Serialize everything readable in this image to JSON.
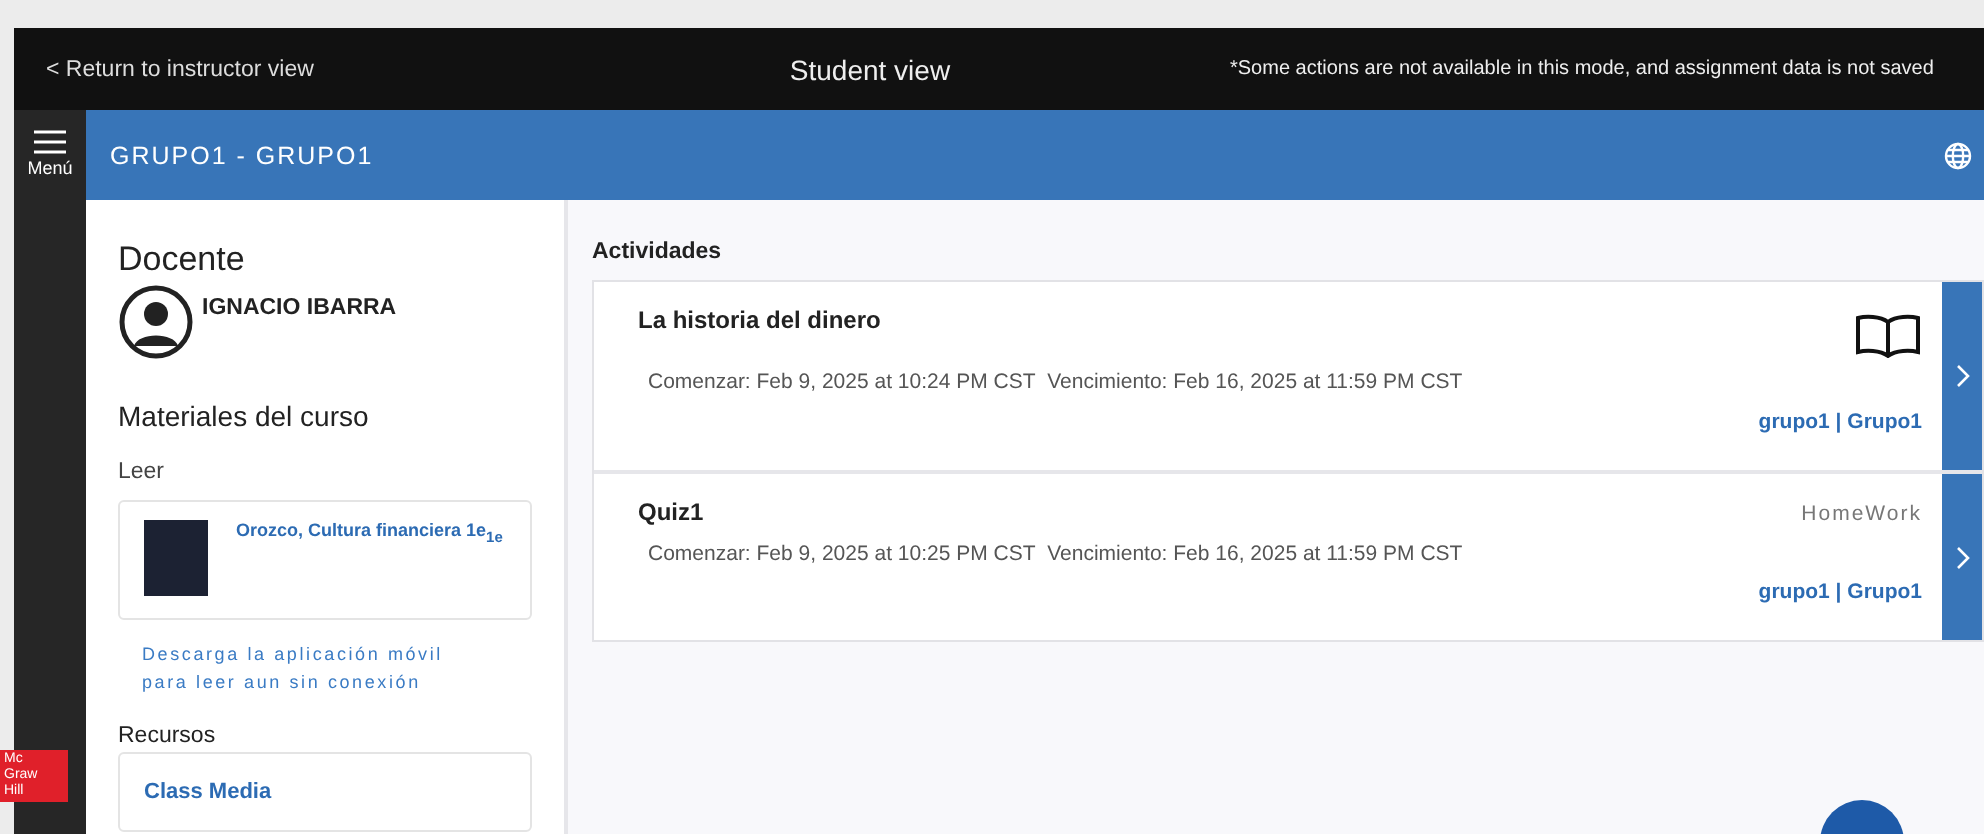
{
  "topbar": {
    "back_link": "< Return to instructor view",
    "title": "Student view",
    "notice": "*Some actions are not available in this mode, and assignment data is not saved"
  },
  "rail": {
    "menu_label": "Menú",
    "logo": "Mc Graw Hill"
  },
  "header": {
    "title": "GRUPO1 - GRUPO1"
  },
  "sidebar": {
    "instructor_heading": "Docente",
    "instructor_name": "IGNACIO IBARRA",
    "materials_heading": "Materiales del curso",
    "read_label": "Leer",
    "book_title": "Orozco, Cultura financiera 1e$_{1e}$",
    "app_link": "Descarga la aplicación móvil para leer aun sin conexión",
    "resources_label": "Recursos",
    "resource_link": "Class Media"
  },
  "activities": {
    "heading": "Actividades",
    "items": [
      {
        "kind": "reading",
        "title": "La historia del dinero",
        "start": "Comenzar: Feb 9, 2025 at 10:24 PM CST",
        "due": "Vencimiento: Feb 16, 2025 at 11:59 PM CST",
        "group": "grupo1 | Grupo1"
      },
      {
        "kind": "homework",
        "type_label": "HomeWork",
        "title": "Quiz1",
        "start": "Comenzar: Feb 9, 2025 at 10:25 PM CST",
        "due": "Vencimiento: Feb 16, 2025 at 11:59 PM CST",
        "group": "grupo1 | Grupo1"
      }
    ]
  }
}
